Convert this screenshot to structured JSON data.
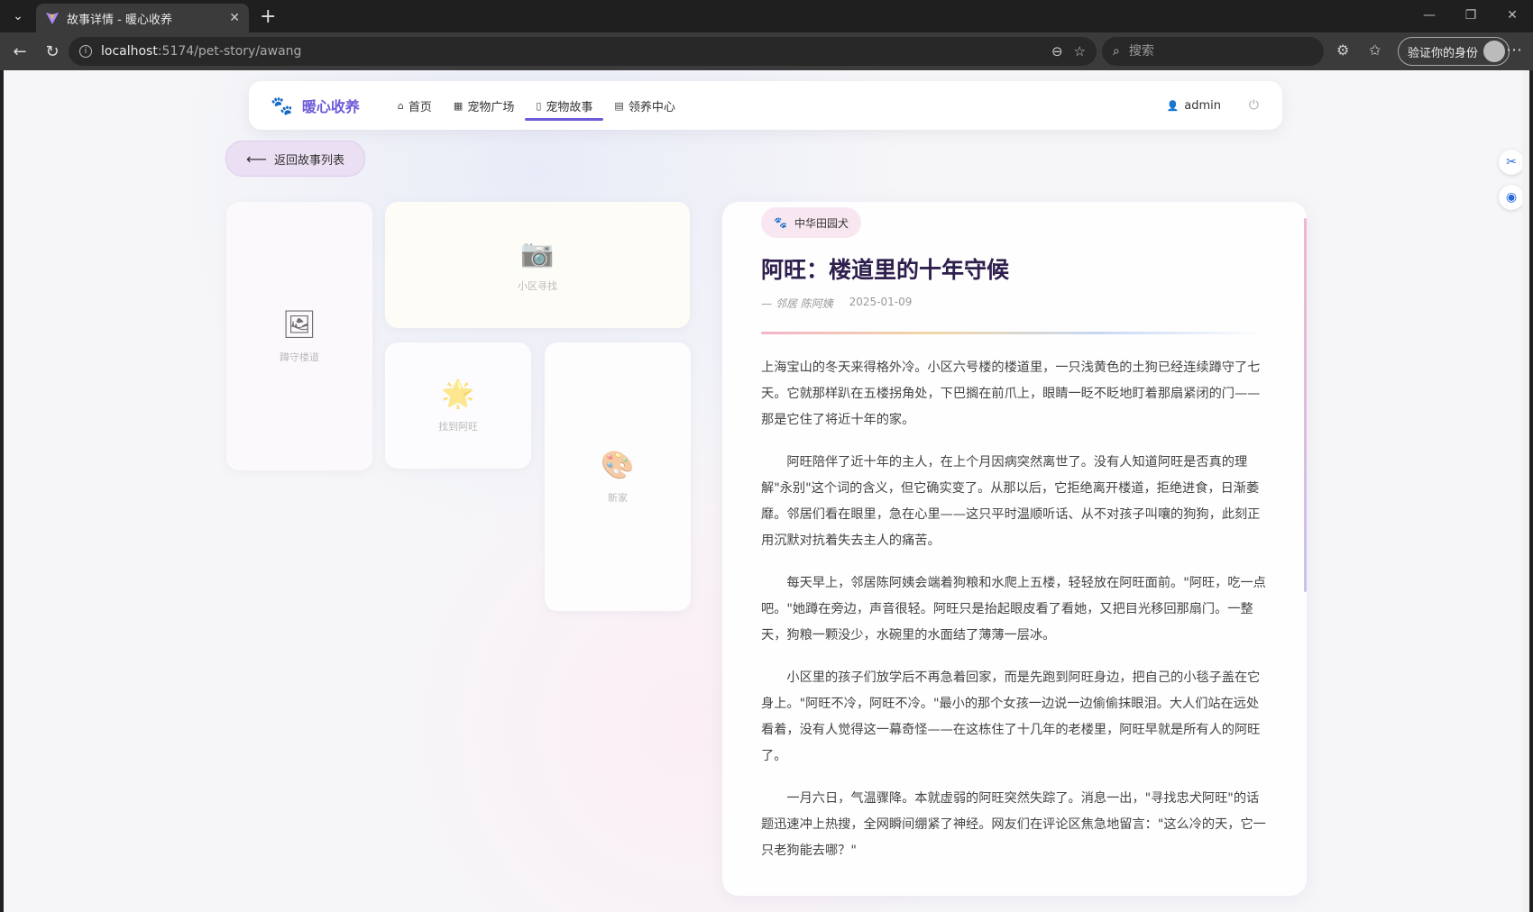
{
  "browser": {
    "tab_title": "故事详情 - 暖心收养",
    "url_host": "localhost",
    "url_path": ":5174/pet-story/awang",
    "search_placeholder": "搜索",
    "profile_label": "验证你的身份"
  },
  "navbar": {
    "brand": "暖心收养",
    "links": [
      {
        "label": "首页",
        "icon": "home-icon"
      },
      {
        "label": "宠物广场",
        "icon": "grid-icon"
      },
      {
        "label": "宠物故事",
        "icon": "book-icon",
        "active": true
      },
      {
        "label": "领养中心",
        "icon": "clipboard-icon"
      }
    ],
    "user": "admin"
  },
  "back_button": "返回故事列表",
  "gallery": [
    {
      "emoji": "🖼",
      "label": "蹲守楼道"
    },
    {
      "emoji": "📷",
      "label": "小区寻找"
    },
    {
      "emoji": "🌟",
      "label": "找到阿旺"
    },
    {
      "emoji": "🎨",
      "label": "新家"
    }
  ],
  "article": {
    "breed": "中华田园犬",
    "title": "阿旺：楼道里的十年守候",
    "author": "— 邻居 陈阿姨",
    "date": "2025-01-09",
    "paragraphs": [
      "上海宝山的冬天来得格外冷。小区六号楼的楼道里，一只浅黄色的土狗已经连续蹲守了七天。它就那样趴在五楼拐角处，下巴搁在前爪上，眼睛一眨不眨地盯着那扇紧闭的门——那是它住了将近十年的家。",
      "阿旺陪伴了近十年的主人，在上个月因病突然离世了。没有人知道阿旺是否真的理解\"永别\"这个词的含义，但它确实变了。从那以后，它拒绝离开楼道，拒绝进食，日渐萎靡。邻居们看在眼里，急在心里——这只平时温顺听话、从不对孩子叫嚷的狗狗，此刻正用沉默对抗着失去主人的痛苦。",
      "每天早上，邻居陈阿姨会端着狗粮和水爬上五楼，轻轻放在阿旺面前。\"阿旺，吃一点吧。\"她蹲在旁边，声音很轻。阿旺只是抬起眼皮看了看她，又把目光移回那扇门。一整天，狗粮一颗没少，水碗里的水面结了薄薄一层冰。",
      "小区里的孩子们放学后不再急着回家，而是先跑到阿旺身边，把自己的小毯子盖在它身上。\"阿旺不冷，阿旺不冷。\"最小的那个女孩一边说一边偷偷抹眼泪。大人们站在远处看着，没有人觉得这一幕奇怪——在这栋住了十几年的老楼里，阿旺早就是所有人的阿旺了。",
      "一月六日，气温骤降。本就虚弱的阿旺突然失踪了。消息一出，\"寻找忠犬阿旺\"的话题迅速冲上热搜，全网瞬间绷紧了神经。网友们在评论区焦急地留言：\"这么冷的天，它一只老狗能去哪？\""
    ]
  }
}
